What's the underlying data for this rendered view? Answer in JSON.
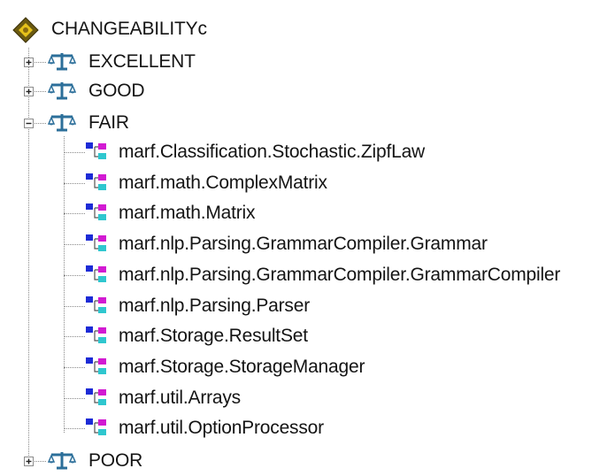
{
  "tree": {
    "root": {
      "label": "CHANGEABILITYc",
      "icon": "diamond-node-icon"
    },
    "categories": [
      {
        "label": "EXCELLENT",
        "expanded": false,
        "icon": "scales-icon"
      },
      {
        "label": "GOOD",
        "expanded": false,
        "icon": "scales-icon"
      },
      {
        "label": "FAIR",
        "expanded": true,
        "icon": "scales-icon",
        "children": [
          "marf.Classification.Stochastic.ZipfLaw",
          "marf.math.ComplexMatrix",
          "marf.math.Matrix",
          "marf.nlp.Parsing.GrammarCompiler.Grammar",
          "marf.nlp.Parsing.GrammarCompiler.GrammarCompiler",
          "marf.nlp.Parsing.Parser",
          "marf.Storage.ResultSet",
          "marf.Storage.StorageManager",
          "marf.util.Arrays",
          "marf.util.OptionProcessor"
        ]
      },
      {
        "label": "POOR",
        "expanded": false,
        "icon": "scales-icon"
      }
    ],
    "class_icon": "class-hierarchy-icon",
    "colors": {
      "root_diamond": "#6b5a10",
      "root_center": "#e6c21a",
      "scales": "#2c6f9a",
      "class_blue": "#1c2bd6",
      "class_magenta": "#d21ad2",
      "class_cyan": "#2fc7cf"
    }
  }
}
